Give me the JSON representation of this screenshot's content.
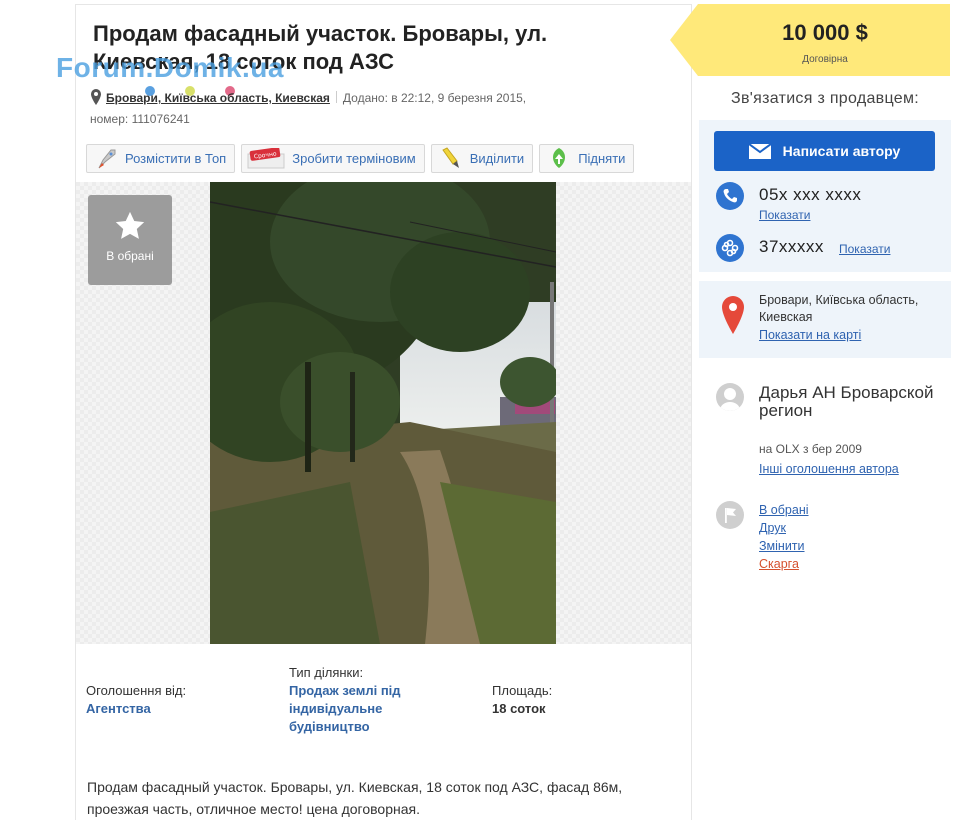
{
  "ad": {
    "title": "Продам фасадный участок. Бровары, ул. Киевская, 18 соток под АЗС",
    "watermark": "Forum.Domik.ua",
    "location": "Бровари, Київська область, Киевская",
    "added": "Додано: в 22:12, 9 березня 2015,",
    "number": "номер: 111076241"
  },
  "actions": [
    {
      "label": "Розмістити в Топ",
      "icon": "rocket-icon"
    },
    {
      "label": "Зробити терміновим",
      "icon": "urgent-stamp-icon",
      "badge": "Срочно"
    },
    {
      "label": "Виділити",
      "icon": "marker-icon"
    },
    {
      "label": "Підняти",
      "icon": "up-arrow-leaf-icon"
    }
  ],
  "favorite": {
    "label": "В обрані"
  },
  "params": [
    {
      "label": "Оголошення від:",
      "value": "Агентства"
    },
    {
      "label": "Тип ділянки:",
      "value": "Продаж землі під індивідуальне будівництво"
    },
    {
      "label": "Площадь:",
      "value": "18 соток"
    }
  ],
  "description": "Продам фасадный участок. Бровары, ул. Киевская, 18 соток под АЗС, фасад 86м, проезжая часть, отличное место! цена договорная.",
  "price": {
    "amount": "10 000 $",
    "note": "Договірна"
  },
  "contact": {
    "heading": "Зв'язатися з продавцем:",
    "write_button": "Написати автору",
    "phone": "05x xxx xxxx",
    "phone_show": "Показати",
    "skype": "37xxxxx",
    "skype_show": "Показати"
  },
  "location_box": {
    "text": "Бровари, Київська область, Киевская",
    "map_link": "Показати на карті"
  },
  "seller": {
    "name": "Дарья АН Броварской регион",
    "since": "на OLX з бер 2009",
    "other_ads": "Інші оголошення автора"
  },
  "side_links": [
    "В обрані",
    "Друк",
    "Змінити",
    "Скарга"
  ],
  "colors": {
    "accent_blue": "#1b63c7",
    "price_yellow": "#ffe97a",
    "link_blue": "#2f63b0",
    "complaint_red": "#d5512e"
  }
}
